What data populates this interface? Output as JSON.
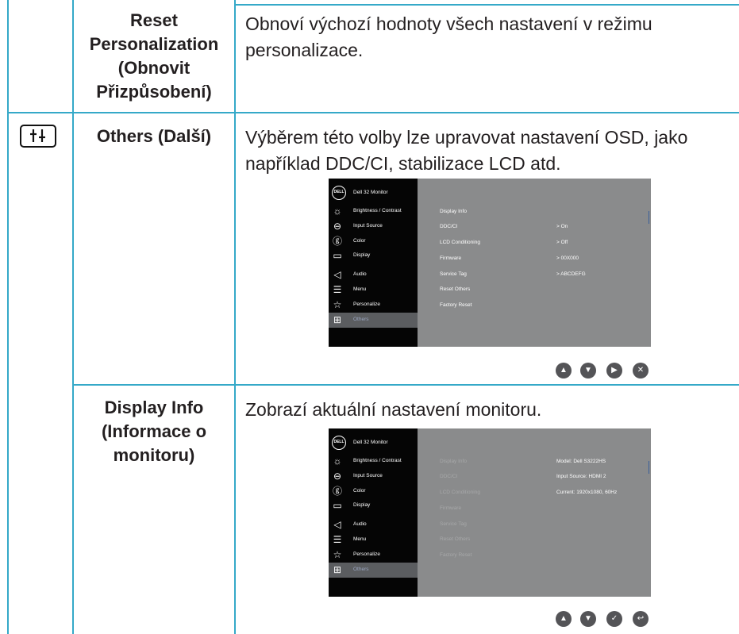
{
  "rows": [
    {
      "label": "Reset Personalization (Obnovit Přizpůsobení)",
      "description": "Obnoví výchozí hodnoty všech nastavení v režimu personalizace."
    },
    {
      "icon": "others-icon",
      "label": "Others (Další)",
      "description": "Výběrem této volby lze upravovat nastavení OSD, jako například DDC/CI, stabilizace LCD atd."
    },
    {
      "label": "Display Info (Informace o monitoru)",
      "description": "Zobrazí aktuální nastavení monitoru."
    }
  ],
  "osd": {
    "logo": "DELL",
    "title": "Dell 32 Monitor",
    "menu": [
      "Brightness / Contrast",
      "Input Source",
      "Color",
      "Display",
      "Audio",
      "Menu",
      "Personalize",
      "Others"
    ],
    "menu_icons": [
      "brightness-icon",
      "input-source-icon",
      "color-icon",
      "display-icon",
      "audio-icon",
      "menu-icon",
      "personalize-icon",
      "others-icon"
    ],
    "submenu": [
      "Display Info",
      "DDC/CI",
      "LCD Conditioning",
      "Firmware",
      "Service Tag",
      "Reset Others",
      "Factory Reset"
    ],
    "values": [
      "> On",
      "> Off",
      "> 00X000",
      "> ABCDEFG"
    ],
    "info_values": [
      "Model: Dell S3222HS",
      "Input Source: HDMI 2",
      "Current: 1920x1080, 60Hz"
    ]
  },
  "nav_buttons_1": [
    "up-icon",
    "down-icon",
    "right-icon",
    "close-icon"
  ],
  "nav_buttons_2": [
    "up-icon",
    "down-icon",
    "check-icon",
    "back-icon"
  ],
  "colors": {
    "grid_line": "#35a9c8",
    "osd_bg": "#8a8b8c",
    "osd_left": "#050505",
    "button": "#545457"
  }
}
